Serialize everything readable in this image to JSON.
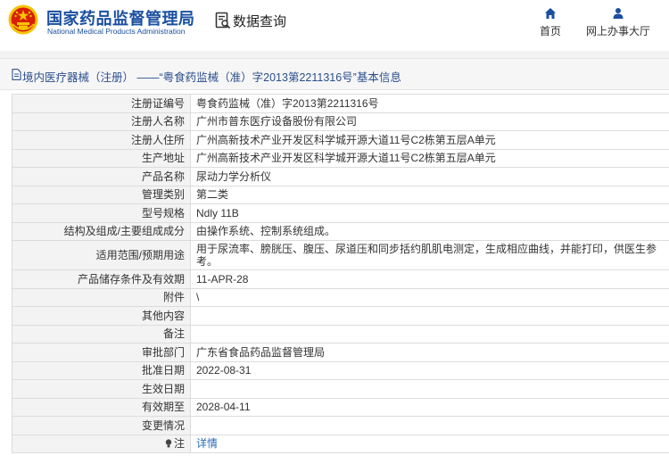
{
  "header": {
    "brand_cn": "国家药品监督管理局",
    "brand_en": "National Medical Products Administration",
    "search_label": "数据查询",
    "nav": {
      "home": "首页",
      "hall": "网上办事大厅"
    }
  },
  "title_bar": {
    "text": "境内医疗器械（注册） ——“粤食药监械（准）字2013第2211316号”基本信息"
  },
  "rows": [
    {
      "label": "注册证编号",
      "value": "粤食药监械（准）字2013第2211316号"
    },
    {
      "label": "注册人名称",
      "value": "广州市普东医疗设备股份有限公司"
    },
    {
      "label": "注册人住所",
      "value": "广州高新技术产业开发区科学城开源大道11号C2栋第五层A单元"
    },
    {
      "label": "生产地址",
      "value": "广州高新技术产业开发区科学城开源大道11号C2栋第五层A单元"
    },
    {
      "label": "产品名称",
      "value": "尿动力学分析仪"
    },
    {
      "label": "管理类别",
      "value": "第二类"
    },
    {
      "label": "型号规格",
      "value": "Ndly 11B"
    },
    {
      "label": "结构及组成/主要组成成分",
      "value": "由操作系统、控制系统组成。"
    },
    {
      "label": "适用范围/预期用途",
      "value": "用于尿流率、膀胱压、腹压、尿道压和同步括约肌肌电测定，生成相应曲线，并能打印，供医生参考。"
    },
    {
      "label": "产品储存条件及有效期",
      "value": "11-APR-28"
    },
    {
      "label": "附件",
      "value": "\\"
    },
    {
      "label": "其他内容",
      "value": ""
    },
    {
      "label": "备注",
      "value": ""
    },
    {
      "label": "审批部门",
      "value": "广东省食品药品监督管理局"
    },
    {
      "label": "批准日期",
      "value": "2022-08-31"
    },
    {
      "label": "生效日期",
      "value": ""
    },
    {
      "label": "有效期至",
      "value": "2028-04-11"
    },
    {
      "label": "变更情况",
      "value": ""
    },
    {
      "label": "注",
      "value": "详情"
    }
  ],
  "colors": {
    "brand_blue": "#1a4fa0",
    "link_blue": "#2a6ab4",
    "emblem_red": "#d81e06",
    "emblem_gold": "#f5c400"
  }
}
